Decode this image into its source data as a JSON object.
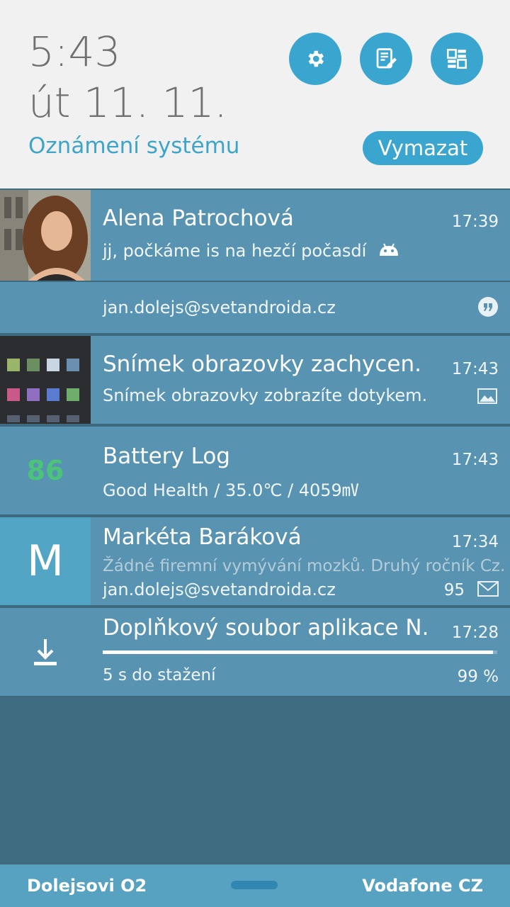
{
  "header": {
    "time": "5:43",
    "date": "út 11. 11.",
    "section_title": "Oznámení systému",
    "clear_label": "Vymazat",
    "quick_buttons": [
      "gear-icon",
      "edit-note-icon",
      "dashboard-icon"
    ]
  },
  "notifications": [
    {
      "title": "Alena Patrochová",
      "time": "17:39",
      "message": "jj, počkáme is na hezčí počasdí",
      "account": "jan.dolejs@svetandroida.cz",
      "icons": [
        "android-icon",
        "hangouts-icon"
      ]
    },
    {
      "title": "Snímek obrazovky zachycen.",
      "time": "17:43",
      "message": "Snímek obrazovky zobrazíte dotykem.",
      "icons": [
        "image-icon"
      ]
    },
    {
      "badge": "86",
      "title": "Battery Log",
      "time": "17:43",
      "message": "Good Health / 35.0℃ / 4059㎷"
    },
    {
      "initial": "M",
      "title": "Markéta Baráková",
      "time": "17:34",
      "message": "Žádné firemní vymývání mozků. Druhý ročník Cz.",
      "account": "jan.dolejs@svetandroida.cz",
      "count": "95",
      "icons": [
        "gmail-icon"
      ]
    },
    {
      "title": "Doplňkový soubor aplikace N.",
      "time": "17:28",
      "status": "5 s do stažení",
      "percent": "99 %",
      "progress": 0.99,
      "icons": [
        "download-icon"
      ]
    }
  ],
  "bottom": {
    "left_carrier": "Dolejsovi O2",
    "right_carrier": "Vodafone CZ"
  },
  "colors": {
    "accent": "#3aa6cf",
    "card": "#5893b1",
    "background": "#3e6b80",
    "battery_green": "#4cc37a"
  }
}
